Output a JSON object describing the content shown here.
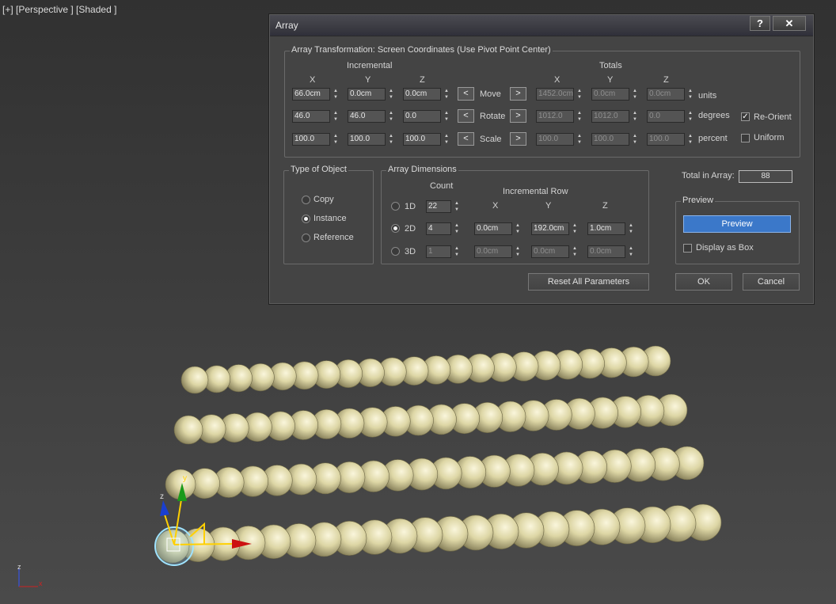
{
  "viewport": {
    "label": "[+] [Perspective ] [Shaded ]",
    "axes": {
      "z": "z",
      "x": "x"
    },
    "gizmo_labels": {
      "y": "y",
      "z": "z"
    }
  },
  "dialog": {
    "title": "Array",
    "help_label": "?",
    "close_label": "✕",
    "transformation": {
      "group_title": "Array Transformation: Screen Coordinates (Use Pivot Point Center)",
      "incremental_label": "Incremental",
      "totals_label": "Totals",
      "axis_headers": [
        "X",
        "Y",
        "Z"
      ],
      "left_arrow": "<",
      "right_arrow": ">",
      "rows": [
        {
          "name": "Move",
          "inc": [
            "66.0cm",
            "0.0cm",
            "0.0cm"
          ],
          "tot": [
            "1452.0cm",
            "0.0cm",
            "0.0cm"
          ],
          "unit": "units"
        },
        {
          "name": "Rotate",
          "inc": [
            "46.0",
            "46.0",
            "0.0"
          ],
          "tot": [
            "1012.0",
            "1012.0",
            "0.0"
          ],
          "unit": "degrees"
        },
        {
          "name": "Scale",
          "inc": [
            "100.0",
            "100.0",
            "100.0"
          ],
          "tot": [
            "100.0",
            "100.0",
            "100.0"
          ],
          "unit": "percent"
        }
      ],
      "reorient": {
        "label": "Re-Orient",
        "checked": true
      },
      "uniform": {
        "label": "Uniform",
        "checked": false
      }
    },
    "type_of_object": {
      "group_title": "Type of Object",
      "options": [
        {
          "label": "Copy",
          "selected": false
        },
        {
          "label": "Instance",
          "selected": true
        },
        {
          "label": "Reference",
          "selected": false
        }
      ]
    },
    "array_dimensions": {
      "group_title": "Array Dimensions",
      "count_label": "Count",
      "incremental_row_label": "Incremental Row",
      "axis_headers": [
        "X",
        "Y",
        "Z"
      ],
      "rows": [
        {
          "label": "1D",
          "selected": false,
          "count": "22",
          "xyz": null
        },
        {
          "label": "2D",
          "selected": true,
          "count": "4",
          "xyz": [
            "0.0cm",
            "192.0cm",
            "1.0cm"
          ]
        },
        {
          "label": "3D",
          "selected": false,
          "count": "1",
          "xyz": [
            "0.0cm",
            "0.0cm",
            "0.0cm"
          ]
        }
      ]
    },
    "total_in_array": {
      "label": "Total in Array:",
      "value": "88"
    },
    "preview": {
      "group_title": "Preview",
      "button_label": "Preview",
      "display_as_box": {
        "label": "Display as Box",
        "checked": false
      }
    },
    "buttons": {
      "reset": "Reset All Parameters",
      "ok": "OK",
      "cancel": "Cancel"
    }
  },
  "colors": {
    "sphere": "#ded7a6",
    "accent": "#3b78c9",
    "dialog_bg": "#444444"
  }
}
